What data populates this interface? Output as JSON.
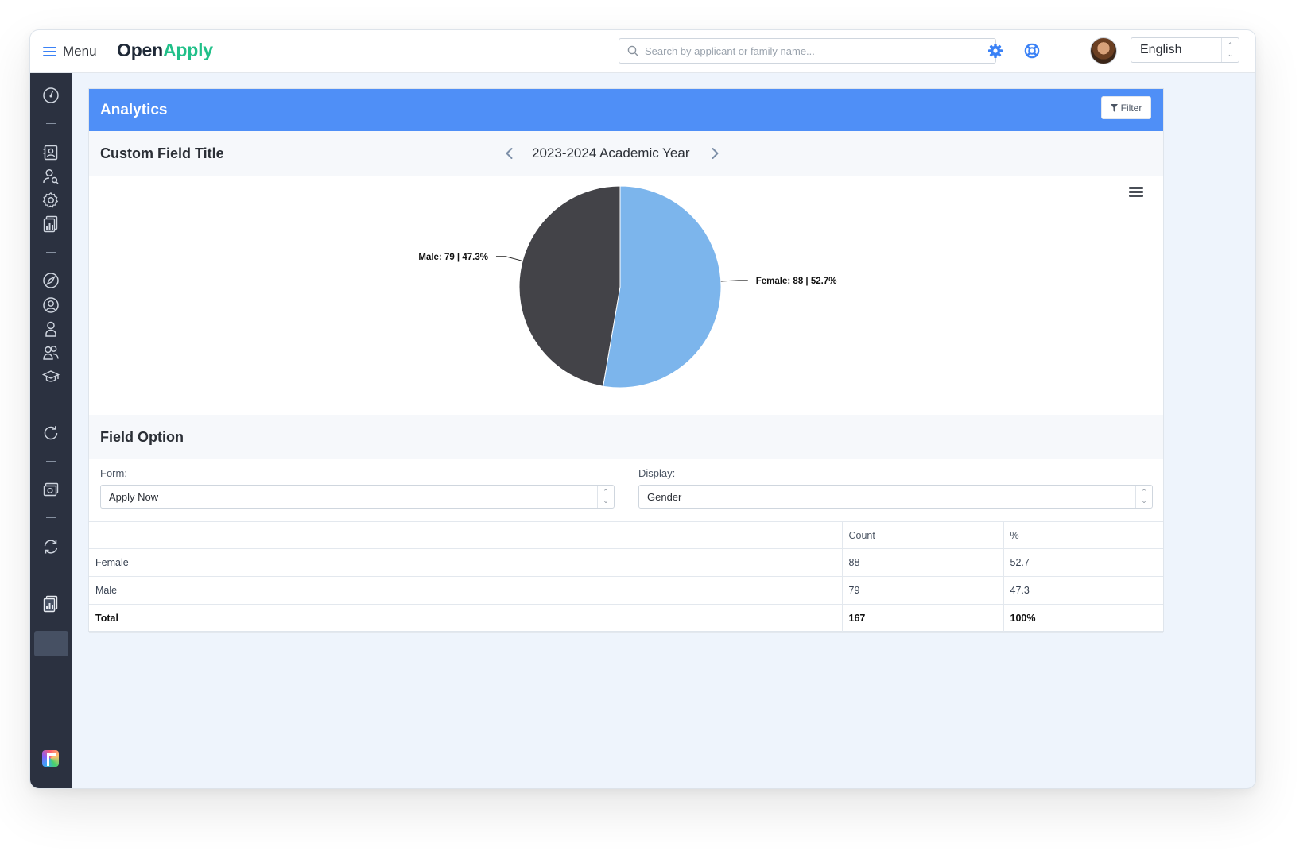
{
  "header": {
    "menu_label": "Menu",
    "logo_open": "Open",
    "logo_apply": "Apply",
    "search_placeholder": "Search by applicant or family name...",
    "language": "English"
  },
  "icons": {
    "settings": "gear-icon",
    "help": "lifebuoy-icon"
  },
  "colors": {
    "accent": "#4f8ff7",
    "logo_green": "#21c089",
    "sidebar": "#2b3140",
    "pie_female": "#7cb5ec",
    "pie_male": "#434348"
  },
  "panel": {
    "title": "Analytics",
    "filter_label": "Filter"
  },
  "chart_section": {
    "title": "Custom Field Title",
    "year_label": "2023-2024 Academic Year"
  },
  "chart_data": {
    "type": "pie",
    "title": "",
    "slices": [
      {
        "name": "Female",
        "value": 88,
        "percent": 52.7,
        "color": "#7cb5ec",
        "label": "Female: 88 | 52.7%"
      },
      {
        "name": "Male",
        "value": 79,
        "percent": 47.3,
        "color": "#434348",
        "label": "Male: 79 | 47.3%"
      }
    ]
  },
  "field_option": {
    "title": "Field Option",
    "form_label": "Form:",
    "form_value": "Apply Now",
    "display_label": "Display:",
    "display_value": "Gender"
  },
  "table": {
    "headers": [
      "",
      "Count",
      "%"
    ],
    "rows": [
      {
        "label": "Female",
        "count": "88",
        "percent": "52.7"
      },
      {
        "label": "Male",
        "count": "79",
        "percent": "47.3"
      }
    ],
    "total": {
      "label": "Total",
      "count": "167",
      "percent": "100%"
    }
  }
}
